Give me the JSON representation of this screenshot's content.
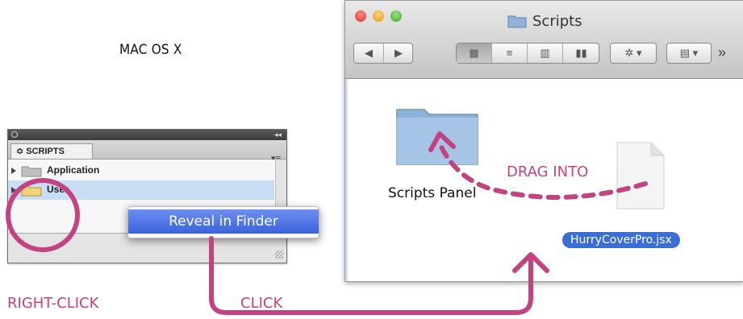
{
  "headline": "MAC OS X",
  "scripts_panel": {
    "tab_label": "SCRIPTS",
    "tab_prefix": "≎",
    "menu_icon": "panel-menu-icon",
    "collapse_icon": "double-chevron-icon",
    "rows": [
      {
        "label": "Application",
        "selected": false
      },
      {
        "label": "User",
        "selected": true
      }
    ]
  },
  "context_menu": {
    "items": [
      "Reveal in Finder"
    ]
  },
  "finder": {
    "title": "Scripts",
    "nav_back": "◀",
    "nav_forward": "▶",
    "view_modes": [
      "icon-view-icon",
      "list-view-icon",
      "column-view-icon",
      "coverflow-view-icon"
    ],
    "action_icon": "gear-icon",
    "arrange_icon": "arrange-icon",
    "overflow": "»",
    "items": [
      {
        "label": "Scripts Panel",
        "kind": "folder"
      },
      {
        "label": "HurryCoverPro.jsx",
        "kind": "file",
        "selected": true
      }
    ]
  },
  "annotations": {
    "right_click": "RIGHT-CLICK",
    "click": "CLICK",
    "drag_into": "DRAG INTO"
  },
  "colors": {
    "accent_pink": "#c2437f",
    "selection_blue": "#3b6ed3",
    "menu_blue": "#4a6fe0"
  }
}
